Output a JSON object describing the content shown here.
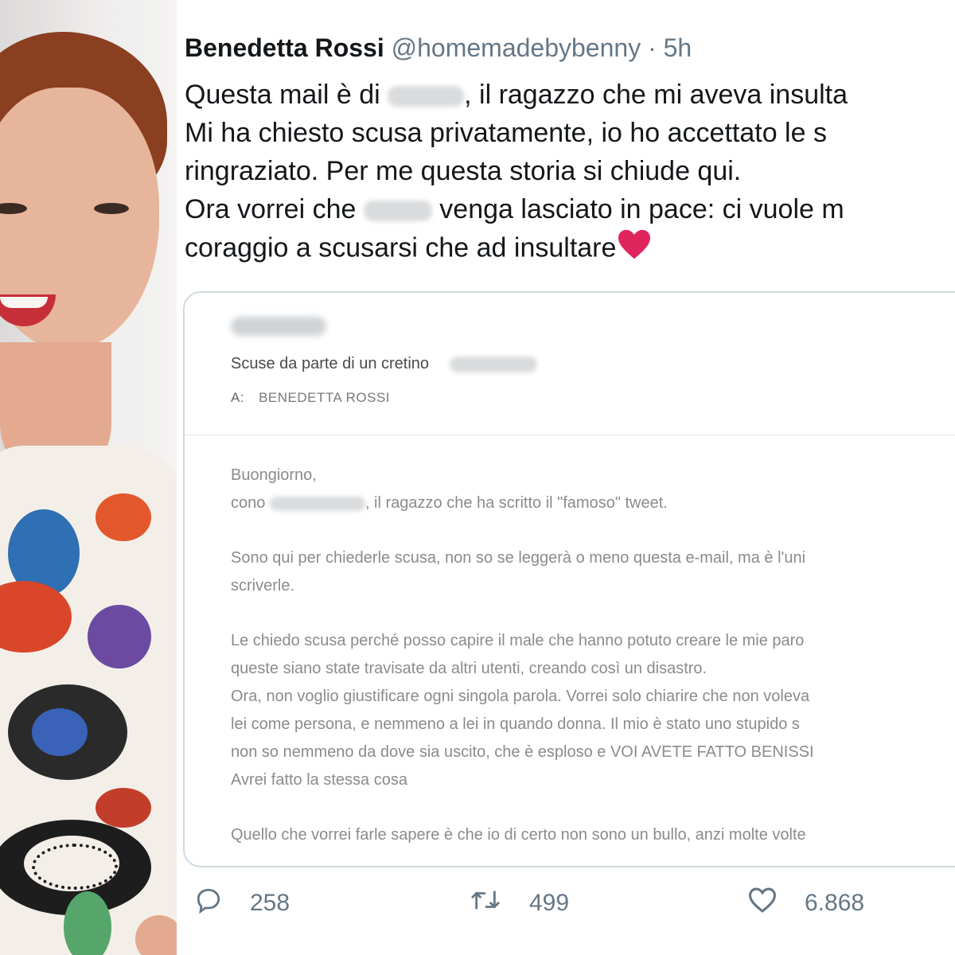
{
  "tweet": {
    "author_name": "Benedetta Rossi",
    "handle": "@homemadebybenny",
    "separator": "·",
    "time": "5h",
    "lines": [
      {
        "before": "Questa mail è di ",
        "after": ", il ragazzo che mi aveva insulta"
      },
      {
        "text": "Mi ha chiesto scusa privatamente, io ho accettato le s"
      },
      {
        "text": "ringraziato. Per me questa storia si chiude qui."
      },
      {
        "before": "Ora vorrei che ",
        "after": " venga lasciato in pace: ci vuole m"
      },
      {
        "text": "coraggio a scusarsi che ad insultare"
      }
    ],
    "emoji_icon": "red-heart-icon",
    "accent_color": "#e0245e"
  },
  "email": {
    "subject": "Scuse da parte di un cretino",
    "to_label": "A:",
    "to_value": "BENEDETTA ROSSI",
    "body": {
      "greeting": "Buongiorno,",
      "intro_before": "cono ",
      "intro_after": ", il ragazzo che ha scritto il \"famoso\" tweet.",
      "p2_line1": "Sono qui per chiederle scusa, non so se leggerà o meno questa e-mail, ma è l'uni",
      "p2_line2": "scriverle.",
      "p3_line1": "Le chiedo scusa perché posso capire il male che hanno potuto creare le mie paro",
      "p3_line2": "queste siano state travisate da altri utenti, creando così un disastro.",
      "p3_line3": "Ora, non voglio giustificare ogni singola parola. Vorrei solo chiarire che non voleva",
      "p3_line4": "lei come persona, e nemmeno a lei in quando donna. Il mio è stato uno stupido s",
      "p3_line5": "non so nemmeno da dove sia uscito, che è esploso e VOI AVETE FATTO BENISSI",
      "p3_line6": "Avrei fatto la stessa cosa",
      "p4_line1": "Quello che vorrei farle sapere è che io di certo non sono un bullo, anzi molte volte"
    }
  },
  "actions": {
    "replies": "258",
    "retweets": "499",
    "likes": "6.868"
  }
}
